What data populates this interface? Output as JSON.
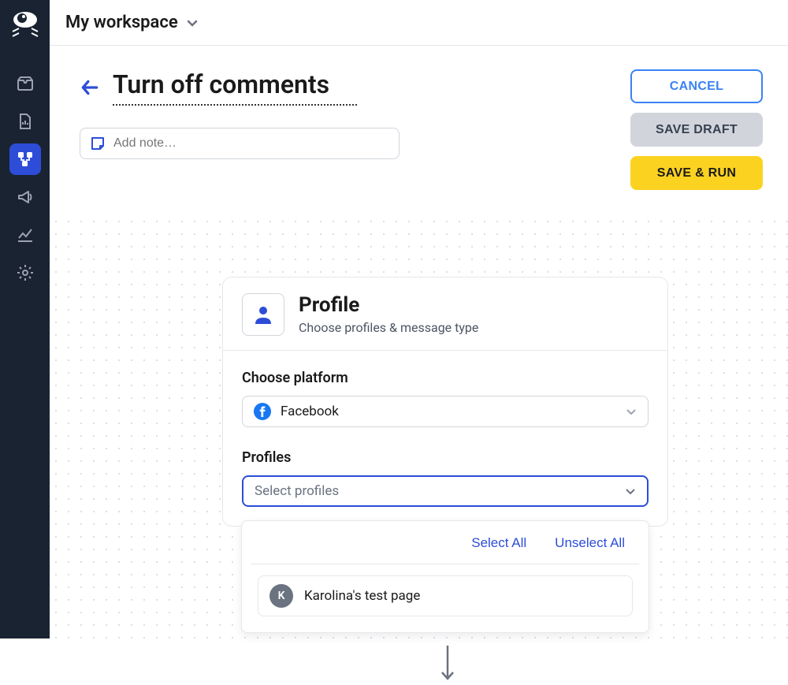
{
  "workspace": {
    "name": "My workspace"
  },
  "page": {
    "title": "Turn off comments",
    "note_placeholder": "Add note…"
  },
  "actions": {
    "cancel": "CANCEL",
    "save_draft": "SAVE DRAFT",
    "save_run": "SAVE & RUN"
  },
  "card": {
    "title": "Profile",
    "subtitle": "Choose profiles & message type",
    "platform_label": "Choose platform",
    "platform_value": "Facebook",
    "profiles_label": "Profiles",
    "profiles_placeholder": "Select profiles"
  },
  "dropdown": {
    "select_all": "Select All",
    "unselect_all": "Unselect All",
    "items": [
      {
        "initial": "K",
        "label": "Karolina's test page"
      }
    ]
  }
}
